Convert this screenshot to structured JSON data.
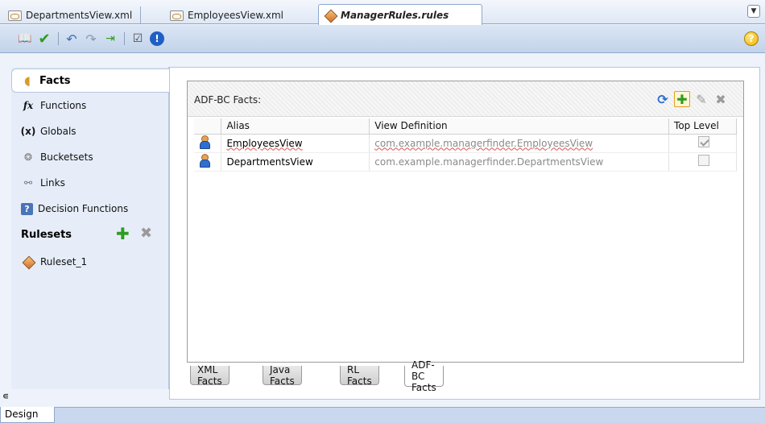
{
  "editor_tabs": [
    {
      "label": "DepartmentsView.xml",
      "icon": "xml-file-icon"
    },
    {
      "label": "EmployeesView.xml",
      "icon": "xml-file-icon"
    },
    {
      "label": "ManagerRules.rules",
      "icon": "rules-file-icon",
      "active": true
    }
  ],
  "toolbar": {
    "buttons": [
      "dictionary-icon",
      "validate-check-icon",
      "undo-icon",
      "redo-icon",
      "import-icon",
      "test-icon",
      "info-icon"
    ],
    "help_icon": "?"
  },
  "leftnav": {
    "selected": "Facts",
    "items": [
      {
        "label": "Functions",
        "icon": "fx"
      },
      {
        "label": "Globals",
        "icon": "(x)"
      },
      {
        "label": "Bucketsets",
        "icon": "bucketset-icon"
      },
      {
        "label": "Links",
        "icon": "link-icon"
      },
      {
        "label": "Decision Functions",
        "icon": "decision-function-icon"
      }
    ],
    "rulesets_heading": "Rulesets",
    "rulesets": [
      "Ruleset_1"
    ]
  },
  "facts_panel": {
    "title": "ADF-BC Facts:",
    "columns": [
      "Alias",
      "View Definition",
      "Top Level"
    ],
    "rows": [
      {
        "alias": "EmployeesView",
        "view_definition": "com.example.managerfinder.EmployeesView",
        "top_level": true
      },
      {
        "alias": "DepartmentsView",
        "view_definition": "com.example.managerfinder.DepartmentsView",
        "top_level": false
      }
    ]
  },
  "fact_tabs": [
    {
      "label": "XML Facts"
    },
    {
      "label": "Java Facts"
    },
    {
      "label": "RL Facts"
    },
    {
      "label": "ADF-BC Facts",
      "active": true
    }
  ],
  "bottom": {
    "design_tab": "Design",
    "collapse_marker": "∊"
  },
  "colors": {
    "accent": "#2e9c1f",
    "panel_bg": "#e6edf8",
    "toolbar_bg": "#c2d3ea"
  }
}
